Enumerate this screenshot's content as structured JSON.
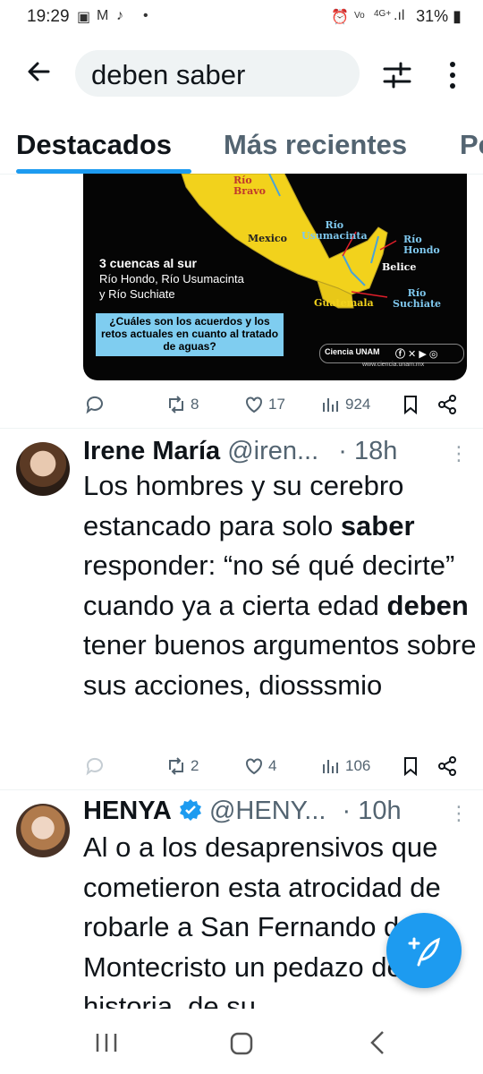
{
  "status_bar": {
    "time": "19:29",
    "battery": "31%",
    "network": "4G+"
  },
  "header": {
    "search_query": "deben saber"
  },
  "tabs": [
    {
      "label": "Destacados",
      "active": true
    },
    {
      "label": "Más recientes",
      "active": false
    },
    {
      "label": "Pe",
      "active": false
    }
  ],
  "media_card": {
    "map_labels": {
      "rio_bravo": "Río\nBravo",
      "mexico": "Mexico",
      "rio_usumacinta": "Río\nUsumacinta",
      "rio_hondo": "Río\nHondo",
      "belice": "Belice",
      "guatemala": "Guatemala",
      "rio_suchiate": "Río\nSuchiate"
    },
    "caption_title": "3 cuencas al sur",
    "caption_lines": [
      "Río Hondo, Río Usumacinta",
      "y Río Suchiate"
    ],
    "question": "¿Cuáles son los acuerdos y los retos actuales en cuanto al tratado de aguas?",
    "brand": "Ciencia UNAM",
    "url": "www.ciencia.unam.mx"
  },
  "post0_stats": {
    "replies": "",
    "reposts": "8",
    "likes": "17",
    "views": "924"
  },
  "tweets": [
    {
      "name": "Irene María",
      "handle": "@iren...",
      "time": "· 18h",
      "body_parts": [
        {
          "t": "Los hombres y su cerebro estancado para solo ",
          "b": false
        },
        {
          "t": "saber",
          "b": true
        },
        {
          "t": " responder: “no sé qué decirte” cuando ya a cierta edad ",
          "b": false
        },
        {
          "t": "deben",
          "b": true
        },
        {
          "t": " tener buenos argumentos sobre sus acciones, diosssmio",
          "b": false
        }
      ],
      "stats": {
        "replies": "",
        "reposts": "2",
        "likes": "4",
        "views": "106"
      }
    },
    {
      "name": "HENYA",
      "verified": true,
      "handle": "@HENY...",
      "time": "· 10h",
      "body": "Al o a los desaprensivos que cometieron esta atrocidad de robarle a San Fernando de Montecristo un pedazo de su historia, de su"
    }
  ],
  "colors": {
    "accent": "#1d9bf0",
    "text": "#0f1419",
    "secondary": "#536471",
    "map_yellow": "#f2d21c",
    "question_box": "#7fcdf0"
  },
  "icons": [
    "back-arrow-icon",
    "filter-icon",
    "more-vert-icon",
    "reply-icon",
    "repost-icon",
    "like-icon",
    "views-icon",
    "bookmark-icon",
    "share-icon",
    "verified-icon",
    "compose-icon",
    "recents-icon",
    "home-icon",
    "back-icon"
  ]
}
